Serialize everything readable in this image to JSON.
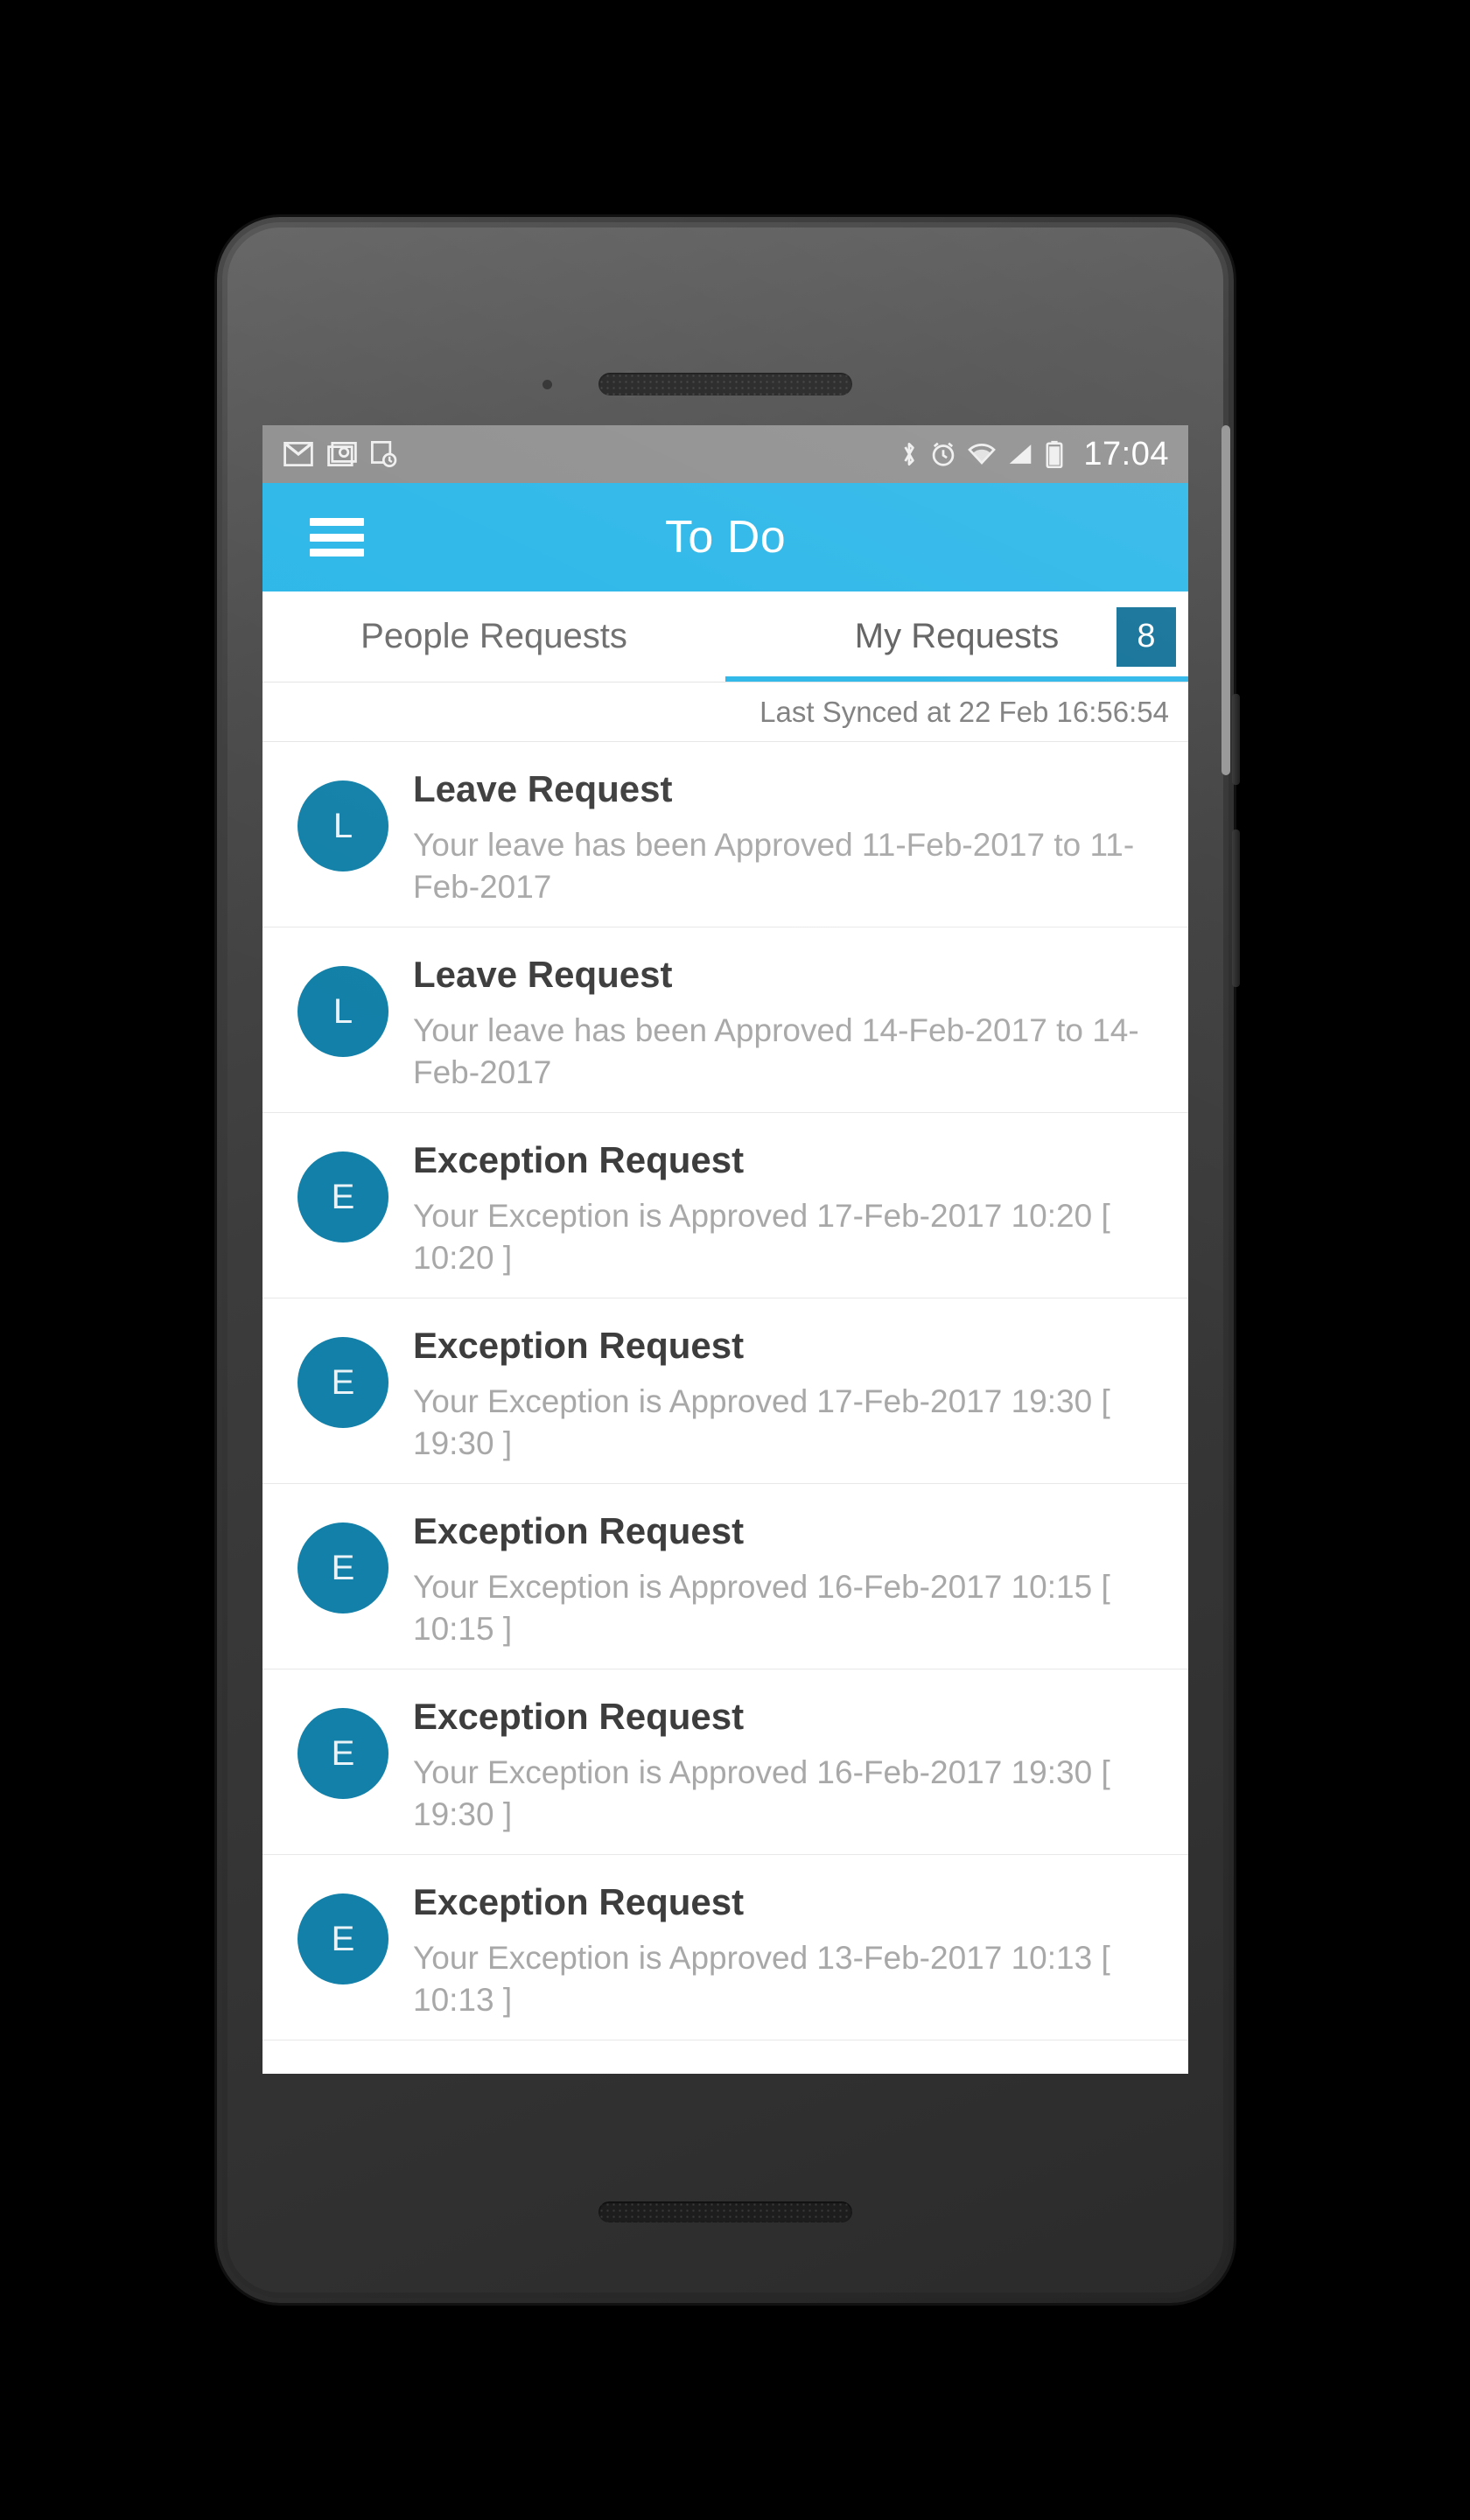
{
  "status_bar": {
    "icons_left": [
      "gmail-icon",
      "camera-photo-icon",
      "screenshot-icon"
    ],
    "icons_right": [
      "bluetooth-icon",
      "alarm-clock-icon",
      "wifi-icon",
      "cellular-signal-icon",
      "battery-icon"
    ],
    "time": "17:04"
  },
  "app_bar": {
    "menu_icon": "hamburger-menu-icon",
    "title": "To Do"
  },
  "tabs": [
    {
      "label": "People Requests",
      "active": false,
      "badge": ""
    },
    {
      "label": "My Requests",
      "active": true,
      "badge": "8"
    }
  ],
  "sync": {
    "text": "Last Synced at 22 Feb 16:56:54"
  },
  "list": {
    "items": [
      {
        "initial": "L",
        "title": "Leave Request",
        "subtitle": "Your leave has been Approved 11-Feb-2017 to 11-Feb-2017"
      },
      {
        "initial": "L",
        "title": "Leave Request",
        "subtitle": "Your leave has been Approved 14-Feb-2017 to 14-Feb-2017"
      },
      {
        "initial": "E",
        "title": "Exception Request",
        "subtitle": "Your Exception is Approved 17-Feb-2017 10:20 [ 10:20 ]"
      },
      {
        "initial": "E",
        "title": "Exception Request",
        "subtitle": "Your Exception is Approved 17-Feb-2017 19:30 [ 19:30 ]"
      },
      {
        "initial": "E",
        "title": "Exception Request",
        "subtitle": "Your Exception is Approved 16-Feb-2017 10:15 [ 10:15 ]"
      },
      {
        "initial": "E",
        "title": "Exception Request",
        "subtitle": "Your Exception is Approved 16-Feb-2017 19:30 [ 19:30 ]"
      },
      {
        "initial": "E",
        "title": "Exception Request",
        "subtitle": "Your Exception is Approved 13-Feb-2017 10:13 [ 10:13 ]"
      }
    ]
  },
  "colors": {
    "accent": "#29b6e8",
    "badge": "#0d6e96",
    "avatar": "#1280a8",
    "status_bar": "#8e8e8e",
    "title_text": "#3d3d3d",
    "sub_text": "#a8a8a8"
  }
}
